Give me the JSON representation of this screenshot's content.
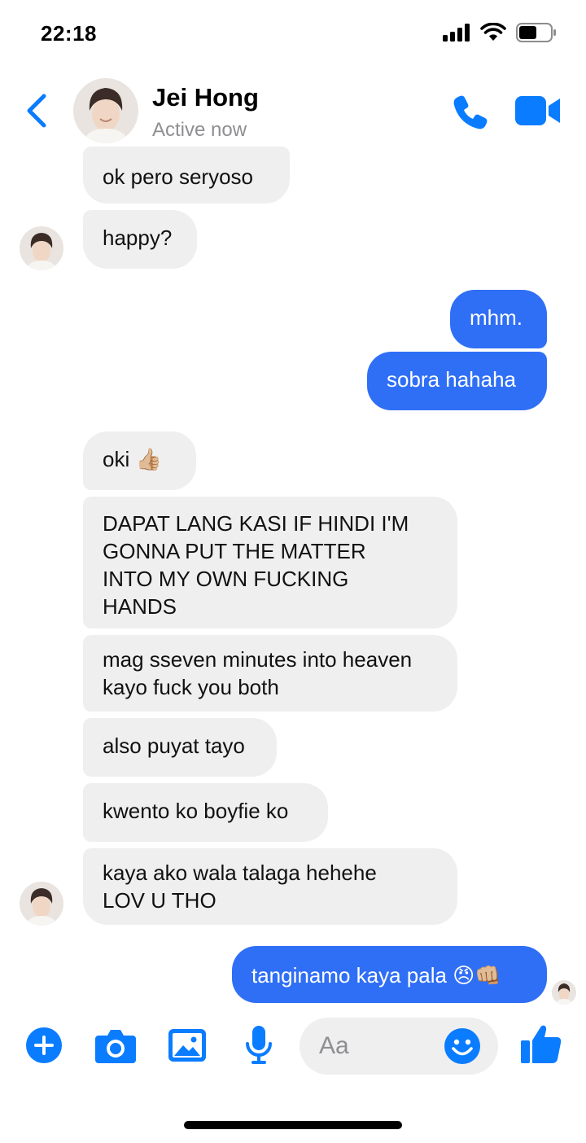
{
  "status_bar": {
    "time": "22:18"
  },
  "header": {
    "contact_name": "Jei Hong",
    "contact_status": "Active now"
  },
  "colors": {
    "accent": "#0a7cff",
    "outgoing_bubble": "#2f6ff6",
    "incoming_bubble": "#efefef"
  },
  "messages": [
    {
      "side": "in",
      "text": "ok pero seryoso"
    },
    {
      "side": "in",
      "text": "happy?"
    },
    {
      "side": "out",
      "text": "mhm."
    },
    {
      "side": "out",
      "text": "sobra hahaha"
    },
    {
      "side": "in",
      "text": "oki 👍🏼"
    },
    {
      "side": "in",
      "lines": [
        "DAPAT LANG KASI IF HINDI I'M",
        "GONNA PUT THE MATTER",
        "INTO MY OWN FUCKING",
        "HANDS"
      ]
    },
    {
      "side": "in",
      "lines": [
        "mag sseven minutes into heaven",
        "kayo fuck you both"
      ]
    },
    {
      "side": "in",
      "text": "also puyat tayo"
    },
    {
      "side": "in",
      "text": "kwento ko boyfie ko"
    },
    {
      "side": "in",
      "lines": [
        "kaya ako wala talaga hehehe",
        "LOV U THO"
      ]
    },
    {
      "side": "out",
      "text": "tanginamo kaya pala 😠👊🏼"
    }
  ],
  "composer": {
    "placeholder": "Aa",
    "icons": [
      "plus-circle-icon",
      "camera-icon",
      "photo-icon",
      "microphone-icon",
      "emoji-icon",
      "thumbs-up-icon"
    ]
  }
}
